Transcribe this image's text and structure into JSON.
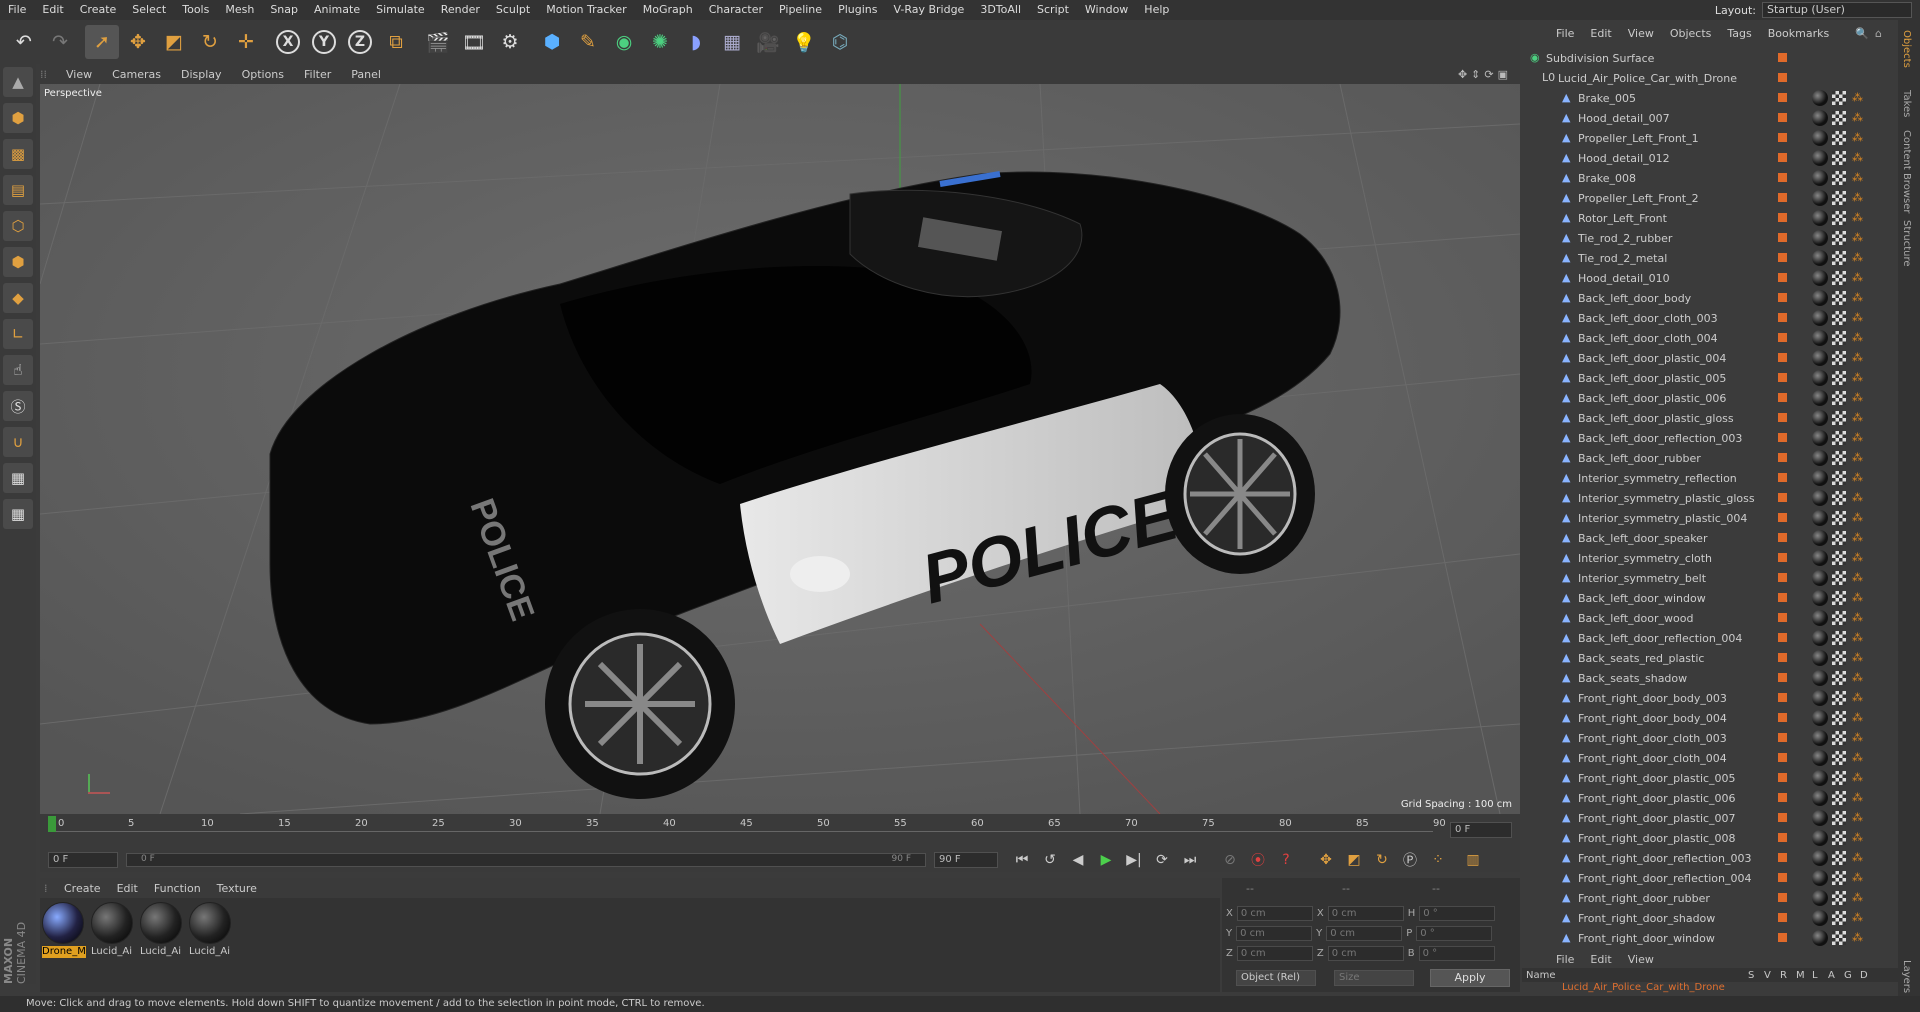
{
  "menubar": {
    "items": [
      "File",
      "Edit",
      "Create",
      "Select",
      "Tools",
      "Mesh",
      "Snap",
      "Animate",
      "Simulate",
      "Render",
      "Sculpt",
      "Motion Tracker",
      "MoGraph",
      "Character",
      "Pipeline",
      "Plugins",
      "V-Ray Bridge",
      "3DToAll",
      "Script",
      "Window",
      "Help"
    ],
    "layout_label": "Layout:",
    "layout_value": "Startup (User)"
  },
  "toolbar": {
    "icons": [
      "undo-icon",
      "redo-icon",
      "select-icon",
      "move-icon",
      "scale-icon",
      "rotate-icon",
      "add-icon",
      "x-axis-icon",
      "y-axis-icon",
      "z-axis-icon",
      "coord-system-icon",
      "render-view-icon",
      "render-picture-icon",
      "render-settings-icon",
      "cube-icon",
      "pen-icon",
      "nurbs-icon",
      "array-icon",
      "deformer-icon",
      "floor-icon",
      "camera-icon",
      "light-icon",
      "python-icon"
    ],
    "axis_labels": [
      "X",
      "Y",
      "Z"
    ]
  },
  "viewport": {
    "menu": [
      "View",
      "Cameras",
      "Display",
      "Options",
      "Filter",
      "Panel"
    ],
    "camera_label": "Perspective",
    "grid_spacing": "Grid Spacing : 100 cm",
    "car_text": "POLICE"
  },
  "timeline": {
    "ticks": [
      "0",
      "5",
      "10",
      "15",
      "20",
      "25",
      "30",
      "35",
      "40",
      "45",
      "50",
      "55",
      "60",
      "65",
      "70",
      "75",
      "80",
      "85",
      "90"
    ],
    "end_field": "0 F"
  },
  "playbar": {
    "current_frame": "0 F",
    "range_start": "0 F",
    "range_end": "90 F",
    "max_frame": "90 F"
  },
  "materials": {
    "menu": [
      "Create",
      "Edit",
      "Function",
      "Texture"
    ],
    "items": [
      "Drone_M",
      "Lucid_Ai",
      "Lucid_Ai",
      "Lucid_Ai"
    ]
  },
  "coordinates": {
    "rows": [
      {
        "a": "X",
        "av": "0 cm",
        "b": "X",
        "bv": "0 cm",
        "c": "H",
        "cv": "0 °"
      },
      {
        "a": "Y",
        "av": "0 cm",
        "b": "Y",
        "bv": "0 cm",
        "c": "P",
        "cv": "0 °"
      },
      {
        "a": "Z",
        "av": "0 cm",
        "b": "Z",
        "bv": "0 cm",
        "c": "B",
        "cv": "0 °"
      }
    ],
    "mode": "Object (Rel)",
    "size": "Size",
    "apply": "Apply",
    "dash1": "--",
    "dash2": "--",
    "dash3": "--"
  },
  "objects": {
    "menu": [
      "File",
      "Edit",
      "View",
      "Objects",
      "Tags",
      "Bookmarks"
    ],
    "root": "Subdivision Surface",
    "group": "Lucid_Air_Police_Car_with_Drone",
    "items": [
      "Brake_005",
      "Hood_detail_007",
      "Propeller_Left_Front_1",
      "Hood_detail_012",
      "Brake_008",
      "Propeller_Left_Front_2",
      "Rotor_Left_Front",
      "Tie_rod_2_rubber",
      "Tie_rod_2_metal",
      "Hood_detail_010",
      "Back_left_door_body",
      "Back_left_door_cloth_003",
      "Back_left_door_cloth_004",
      "Back_left_door_plastic_004",
      "Back_left_door_plastic_005",
      "Back_left_door_plastic_006",
      "Back_left_door_plastic_gloss",
      "Back_left_door_reflection_003",
      "Back_left_door_rubber",
      "Interior_symmetry_reflection",
      "Interior_symmetry_plastic_gloss",
      "Interior_symmetry_plastic_004",
      "Back_left_door_speaker",
      "Interior_symmetry_cloth",
      "Interior_symmetry_belt",
      "Back_left_door_window",
      "Back_left_door_wood",
      "Back_left_door_reflection_004",
      "Back_seats_red_plastic",
      "Back_seats_shadow",
      "Front_right_door_body_003",
      "Front_right_door_body_004",
      "Front_right_door_cloth_003",
      "Front_right_door_cloth_004",
      "Front_right_door_plastic_005",
      "Front_right_door_plastic_006",
      "Front_right_door_plastic_007",
      "Front_right_door_plastic_008",
      "Front_right_door_reflection_003",
      "Front_right_door_reflection_004",
      "Front_right_door_rubber",
      "Front_right_door_shadow",
      "Front_right_door_window"
    ]
  },
  "layers": {
    "menu": [
      "File",
      "Edit",
      "View"
    ],
    "col_name": "Name",
    "cols": [
      "S",
      "V",
      "R",
      "M",
      "L",
      "A",
      "G",
      "D"
    ],
    "row": "Lucid_Air_Police_Car_with_Drone"
  },
  "right_tabs": [
    "Objects",
    "Takes",
    "Content Browser",
    "Structure",
    "Layers"
  ],
  "status": "Move: Click and drag to move elements. Hold down SHIFT to quantize movement / add to the selection in point mode, CTRL to remove.",
  "brand": {
    "maxon": "MAXON",
    "c4d": "CINEMA 4D"
  }
}
